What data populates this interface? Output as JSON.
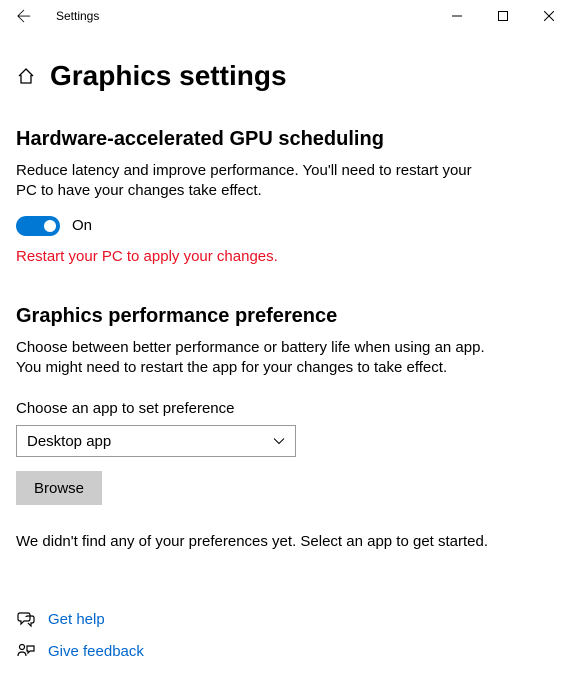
{
  "titlebar": {
    "label": "Settings"
  },
  "page": {
    "title": "Graphics settings"
  },
  "section1": {
    "heading": "Hardware-accelerated GPU scheduling",
    "description": "Reduce latency and improve performance. You'll need to restart your PC to have your changes take effect.",
    "toggle_state": "On",
    "warning": "Restart your PC to apply your changes."
  },
  "section2": {
    "heading": "Graphics performance preference",
    "description": "Choose between better performance or battery life when using an app. You might need to restart the app for your changes to take effect.",
    "field_label": "Choose an app to set preference",
    "dropdown_value": "Desktop app",
    "browse_label": "Browse",
    "empty_message": "We didn't find any of your preferences yet. Select an app to get started."
  },
  "footer": {
    "help_label": "Get help",
    "feedback_label": "Give feedback"
  }
}
